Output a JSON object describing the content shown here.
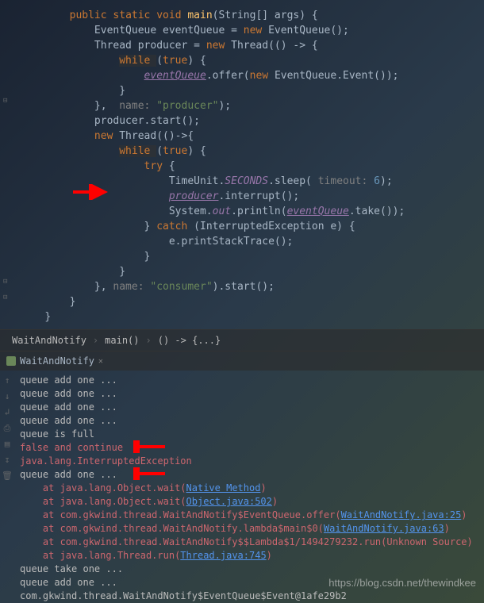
{
  "code": {
    "lines": [
      {
        "indent": 2,
        "tokens": [
          {
            "t": "public ",
            "c": "kw"
          },
          {
            "t": "static void ",
            "c": "kw"
          },
          {
            "t": "main",
            "c": "method"
          },
          {
            "t": "(String[] args) {",
            "c": ""
          }
        ]
      },
      {
        "indent": 3,
        "tokens": [
          {
            "t": "EventQueue eventQueue = ",
            "c": ""
          },
          {
            "t": "new ",
            "c": "kw"
          },
          {
            "t": "EventQueue();",
            "c": ""
          }
        ]
      },
      {
        "indent": 3,
        "tokens": [
          {
            "t": "Thread producer = ",
            "c": ""
          },
          {
            "t": "new ",
            "c": "kw"
          },
          {
            "t": "Thread(() -> {",
            "c": ""
          }
        ]
      },
      {
        "indent": 4,
        "tokens": [
          {
            "t": "while ",
            "c": "kw",
            "bg": true
          },
          {
            "t": "(",
            "c": ""
          },
          {
            "t": "true",
            "c": "kw"
          },
          {
            "t": ") {",
            "c": ""
          }
        ]
      },
      {
        "indent": 5,
        "tokens": [
          {
            "t": "eventQueue",
            "c": "field underline"
          },
          {
            "t": ".offer(",
            "c": ""
          },
          {
            "t": "new ",
            "c": "kw"
          },
          {
            "t": "EventQueue.Event());",
            "c": ""
          }
        ]
      },
      {
        "indent": 4,
        "tokens": [
          {
            "t": "}",
            "c": ""
          }
        ]
      },
      {
        "indent": 3,
        "tokens": [
          {
            "t": "}, ",
            "c": ""
          },
          {
            "t": " name: ",
            "c": "param"
          },
          {
            "t": "\"producer\"",
            "c": "str"
          },
          {
            "t": ");",
            "c": ""
          }
        ]
      },
      {
        "indent": 3,
        "tokens": [
          {
            "t": "producer.start();",
            "c": ""
          }
        ]
      },
      {
        "indent": 3,
        "tokens": [
          {
            "t": "new ",
            "c": "kw"
          },
          {
            "t": "Thread(()->{",
            "c": ""
          }
        ]
      },
      {
        "indent": 4,
        "tokens": [
          {
            "t": "while ",
            "c": "kw",
            "bg": true
          },
          {
            "t": "(",
            "c": ""
          },
          {
            "t": "true",
            "c": "kw"
          },
          {
            "t": ") {",
            "c": ""
          }
        ]
      },
      {
        "indent": 5,
        "tokens": [
          {
            "t": "try ",
            "c": "kw"
          },
          {
            "t": "{",
            "c": ""
          }
        ]
      },
      {
        "indent": 6,
        "tokens": [
          {
            "t": "TimeUnit.",
            "c": ""
          },
          {
            "t": "SECONDS",
            "c": "static-field"
          },
          {
            "t": ".sleep(",
            "c": ""
          },
          {
            "t": " timeout: ",
            "c": "param"
          },
          {
            "t": "6",
            "c": "num"
          },
          {
            "t": ");",
            "c": ""
          }
        ]
      },
      {
        "indent": 6,
        "tokens": [
          {
            "t": "producer",
            "c": "field underline"
          },
          {
            "t": ".interrupt();",
            "c": ""
          }
        ]
      },
      {
        "indent": 6,
        "tokens": [
          {
            "t": "System.",
            "c": ""
          },
          {
            "t": "out",
            "c": "static-field"
          },
          {
            "t": ".println(",
            "c": ""
          },
          {
            "t": "eventQueue",
            "c": "field underline"
          },
          {
            "t": ".take());",
            "c": ""
          }
        ]
      },
      {
        "indent": 5,
        "tokens": [
          {
            "t": "} ",
            "c": ""
          },
          {
            "t": "catch ",
            "c": "kw"
          },
          {
            "t": "(InterruptedException e) {",
            "c": ""
          }
        ]
      },
      {
        "indent": 6,
        "tokens": [
          {
            "t": "e.printStackTrace();",
            "c": ""
          }
        ]
      },
      {
        "indent": 5,
        "tokens": [
          {
            "t": "}",
            "c": ""
          }
        ]
      },
      {
        "indent": 4,
        "tokens": [
          {
            "t": "}",
            "c": ""
          }
        ]
      },
      {
        "indent": 3,
        "tokens": [
          {
            "t": "}, ",
            "c": ""
          },
          {
            "t": "name: ",
            "c": "param"
          },
          {
            "t": "\"consumer\"",
            "c": "str"
          },
          {
            "t": ").start();",
            "c": ""
          }
        ]
      },
      {
        "indent": 2,
        "tokens": [
          {
            "t": "}",
            "c": ""
          }
        ]
      },
      {
        "indent": 1,
        "tokens": [
          {
            "t": "}",
            "c": ""
          }
        ]
      }
    ]
  },
  "breadcrumb": {
    "parts": [
      "WaitAndNotify",
      "main()",
      "() -> {...}"
    ]
  },
  "run_tab": {
    "label": "WaitAndNotify"
  },
  "console": {
    "lines": [
      {
        "text": "queue add one ...",
        "type": "stdout"
      },
      {
        "text": "queue add one ...",
        "type": "stdout"
      },
      {
        "text": "queue add one ...",
        "type": "stdout"
      },
      {
        "text": "queue add one ...",
        "type": "stdout"
      },
      {
        "text": "queue is full",
        "type": "stdout"
      },
      {
        "text": "false and continue",
        "type": "stderr"
      },
      {
        "text": "java.lang.InterruptedException",
        "type": "stderr"
      },
      {
        "text": "queue add one ...",
        "type": "stdout"
      },
      {
        "text": "    at java.lang.Object.wait(",
        "type": "stderr",
        "link": "Native Method",
        "after": ")"
      },
      {
        "text": "    at java.lang.Object.wait(",
        "type": "stderr",
        "link": "Object.java:502",
        "after": ")"
      },
      {
        "text": "    at com.gkwind.thread.WaitAndNotify$EventQueue.offer(",
        "type": "stderr",
        "link": "WaitAndNotify.java:25",
        "after": ")"
      },
      {
        "text": "    at com.gkwind.thread.WaitAndNotify.lambda$main$0(",
        "type": "stderr",
        "link": "WaitAndNotify.java:63",
        "after": ")"
      },
      {
        "text": "    at com.gkwind.thread.WaitAndNotify$$Lambda$1/1494279232.run(Unknown Source)",
        "type": "stderr"
      },
      {
        "text": "    at java.lang.Thread.run(",
        "type": "stderr",
        "link": "Thread.java:745",
        "after": ")"
      },
      {
        "text": "queue take one ...",
        "type": "stdout"
      },
      {
        "text": "queue add one ...",
        "type": "stdout"
      },
      {
        "text": "com.gkwind.thread.WaitAndNotify$EventQueue$Event@1afe29b2",
        "type": "stdout"
      }
    ]
  },
  "watermark": "https://blog.csdn.net/thewindkee"
}
